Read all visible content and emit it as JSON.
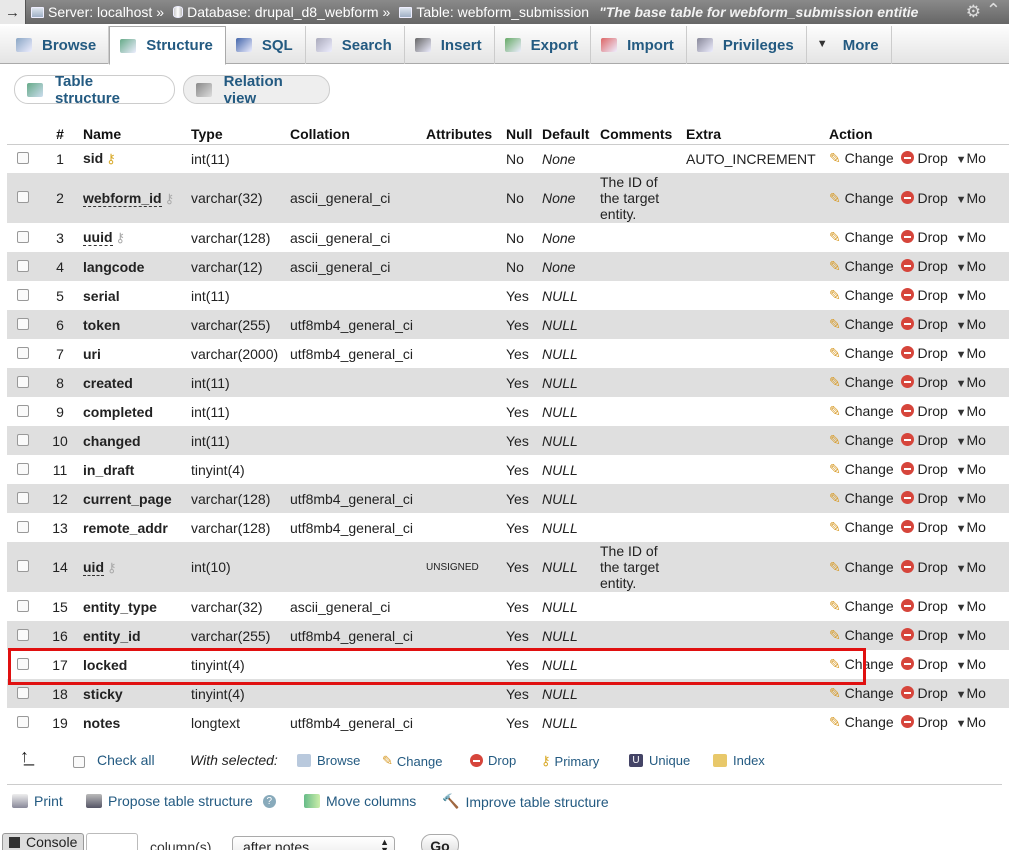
{
  "breadcrumb": {
    "server": "Server: localhost",
    "database": "Database: drupal_d8_webform",
    "table": "Table: webform_submission",
    "comment": "\"The base table for webform_submission entitie",
    "sep": "»"
  },
  "tabs": [
    {
      "label": "Browse",
      "icon": "browse-icon",
      "active": false
    },
    {
      "label": "Structure",
      "icon": "structure-icon",
      "active": true
    },
    {
      "label": "SQL",
      "icon": "sql-icon",
      "active": false
    },
    {
      "label": "Search",
      "icon": "search-icon",
      "active": false
    },
    {
      "label": "Insert",
      "icon": "insert-icon",
      "active": false
    },
    {
      "label": "Export",
      "icon": "export-icon",
      "active": false
    },
    {
      "label": "Import",
      "icon": "import-icon",
      "active": false
    },
    {
      "label": "Privileges",
      "icon": "privileges-icon",
      "active": false
    },
    {
      "label": "More",
      "icon": "chevron-down-icon",
      "active": false
    }
  ],
  "subtabs": {
    "table_structure": "Table structure",
    "relation_view": "Relation view"
  },
  "columns": {
    "num": "#",
    "name": "Name",
    "type": "Type",
    "collation": "Collation",
    "attributes": "Attributes",
    "null": "Null",
    "default": "Default",
    "comments": "Comments",
    "extra": "Extra",
    "action": "Action"
  },
  "actions": {
    "change": "Change",
    "drop": "Drop",
    "more": "Mo"
  },
  "rows": [
    {
      "n": "1",
      "name": "sid",
      "key": "primary",
      "type": "int(11)",
      "collation": "",
      "attributes": "",
      "null": "No",
      "default": "None",
      "comments": "",
      "extra": "AUTO_INCREMENT"
    },
    {
      "n": "2",
      "name": "webform_id",
      "key": "index",
      "type": "varchar(32)",
      "collation": "ascii_general_ci",
      "attributes": "",
      "null": "No",
      "default": "None",
      "comments": "The ID of the target entity.",
      "extra": ""
    },
    {
      "n": "3",
      "name": "uuid",
      "key": "index",
      "type": "varchar(128)",
      "collation": "ascii_general_ci",
      "attributes": "",
      "null": "No",
      "default": "None",
      "comments": "",
      "extra": ""
    },
    {
      "n": "4",
      "name": "langcode",
      "key": "",
      "type": "varchar(12)",
      "collation": "ascii_general_ci",
      "attributes": "",
      "null": "No",
      "default": "None",
      "comments": "",
      "extra": ""
    },
    {
      "n": "5",
      "name": "serial",
      "key": "",
      "type": "int(11)",
      "collation": "",
      "attributes": "",
      "null": "Yes",
      "default": "NULL",
      "comments": "",
      "extra": ""
    },
    {
      "n": "6",
      "name": "token",
      "key": "",
      "type": "varchar(255)",
      "collation": "utf8mb4_general_ci",
      "attributes": "",
      "null": "Yes",
      "default": "NULL",
      "comments": "",
      "extra": ""
    },
    {
      "n": "7",
      "name": "uri",
      "key": "",
      "type": "varchar(2000)",
      "collation": "utf8mb4_general_ci",
      "attributes": "",
      "null": "Yes",
      "default": "NULL",
      "comments": "",
      "extra": ""
    },
    {
      "n": "8",
      "name": "created",
      "key": "",
      "type": "int(11)",
      "collation": "",
      "attributes": "",
      "null": "Yes",
      "default": "NULL",
      "comments": "",
      "extra": ""
    },
    {
      "n": "9",
      "name": "completed",
      "key": "",
      "type": "int(11)",
      "collation": "",
      "attributes": "",
      "null": "Yes",
      "default": "NULL",
      "comments": "",
      "extra": ""
    },
    {
      "n": "10",
      "name": "changed",
      "key": "",
      "type": "int(11)",
      "collation": "",
      "attributes": "",
      "null": "Yes",
      "default": "NULL",
      "comments": "",
      "extra": ""
    },
    {
      "n": "11",
      "name": "in_draft",
      "key": "",
      "type": "tinyint(4)",
      "collation": "",
      "attributes": "",
      "null": "Yes",
      "default": "NULL",
      "comments": "",
      "extra": ""
    },
    {
      "n": "12",
      "name": "current_page",
      "key": "",
      "type": "varchar(128)",
      "collation": "utf8mb4_general_ci",
      "attributes": "",
      "null": "Yes",
      "default": "NULL",
      "comments": "",
      "extra": ""
    },
    {
      "n": "13",
      "name": "remote_addr",
      "key": "",
      "type": "varchar(128)",
      "collation": "utf8mb4_general_ci",
      "attributes": "",
      "null": "Yes",
      "default": "NULL",
      "comments": "",
      "extra": ""
    },
    {
      "n": "14",
      "name": "uid",
      "key": "index",
      "type": "int(10)",
      "collation": "",
      "attributes": "UNSIGNED",
      "null": "Yes",
      "default": "NULL",
      "comments": "The ID of the target entity.",
      "extra": ""
    },
    {
      "n": "15",
      "name": "entity_type",
      "key": "",
      "type": "varchar(32)",
      "collation": "ascii_general_ci",
      "attributes": "",
      "null": "Yes",
      "default": "NULL",
      "comments": "",
      "extra": ""
    },
    {
      "n": "16",
      "name": "entity_id",
      "key": "",
      "type": "varchar(255)",
      "collation": "utf8mb4_general_ci",
      "attributes": "",
      "null": "Yes",
      "default": "NULL",
      "comments": "",
      "extra": ""
    },
    {
      "n": "17",
      "name": "locked",
      "key": "",
      "type": "tinyint(4)",
      "collation": "",
      "attributes": "",
      "null": "Yes",
      "default": "NULL",
      "comments": "",
      "extra": ""
    },
    {
      "n": "18",
      "name": "sticky",
      "key": "",
      "type": "tinyint(4)",
      "collation": "",
      "attributes": "",
      "null": "Yes",
      "default": "NULL",
      "comments": "",
      "extra": ""
    },
    {
      "n": "19",
      "name": "notes",
      "key": "",
      "type": "longtext",
      "collation": "utf8mb4_general_ci",
      "attributes": "",
      "null": "Yes",
      "default": "NULL",
      "comments": "",
      "extra": ""
    }
  ],
  "highlight_color": "#e01010",
  "with_selected": {
    "check_all": "Check all",
    "label": "With selected:",
    "browse": "Browse",
    "change": "Change",
    "drop": "Drop",
    "primary": "Primary",
    "unique": "Unique",
    "index": "Index"
  },
  "tools": {
    "print": "Print",
    "propose": "Propose table structure",
    "move": "Move columns",
    "improve": "Improve table structure"
  },
  "bottom": {
    "console": "Console",
    "columns_label": "column(s)",
    "after_select": "after notes",
    "go": "Go"
  }
}
